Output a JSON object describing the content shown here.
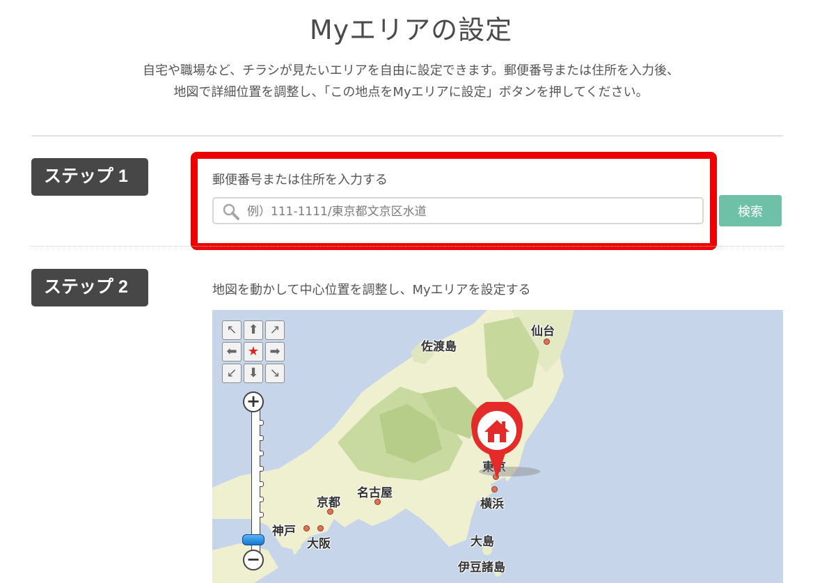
{
  "page": {
    "title": "Myエリアの設定",
    "description_line1": "自宅や職場など、チラシが見たいエリアを自由に設定できます。郵便番号または住所を入力後、",
    "description_line2": "地図で詳細位置を調整し、「この地点をMyエリアに設定」ボタンを押してください。"
  },
  "step1": {
    "badge": "ステップ 1",
    "label": "郵便番号または住所を入力する",
    "search_placeholder": "例）111-1111/東京都文京区水道",
    "search_value": "",
    "search_button": "検索",
    "highlight_color": "#ee0000"
  },
  "step2": {
    "badge": "ステップ 2",
    "label": "地図を動かして中心位置を調整し、Myエリアを設定する"
  },
  "map": {
    "places": {
      "sendai": "仙台",
      "sadogashima": "佐渡島",
      "tokyo": "東京",
      "nagoya": "名古屋",
      "kyoto": "京都",
      "yokohama": "横浜",
      "kobe": "神戸",
      "osaka": "大阪",
      "oshima": "大島",
      "izu": "伊豆諸島"
    },
    "marker_icon": "home-pin-icon",
    "zoom_level_fraction": 0.03,
    "colors": {
      "sea": "#c7d5ea",
      "land": "#eef0d0",
      "forest": "#b9cf8c",
      "marker": "#e52a2a"
    }
  },
  "colors": {
    "badge": "#474747",
    "search_button": "#6ec0a7"
  }
}
